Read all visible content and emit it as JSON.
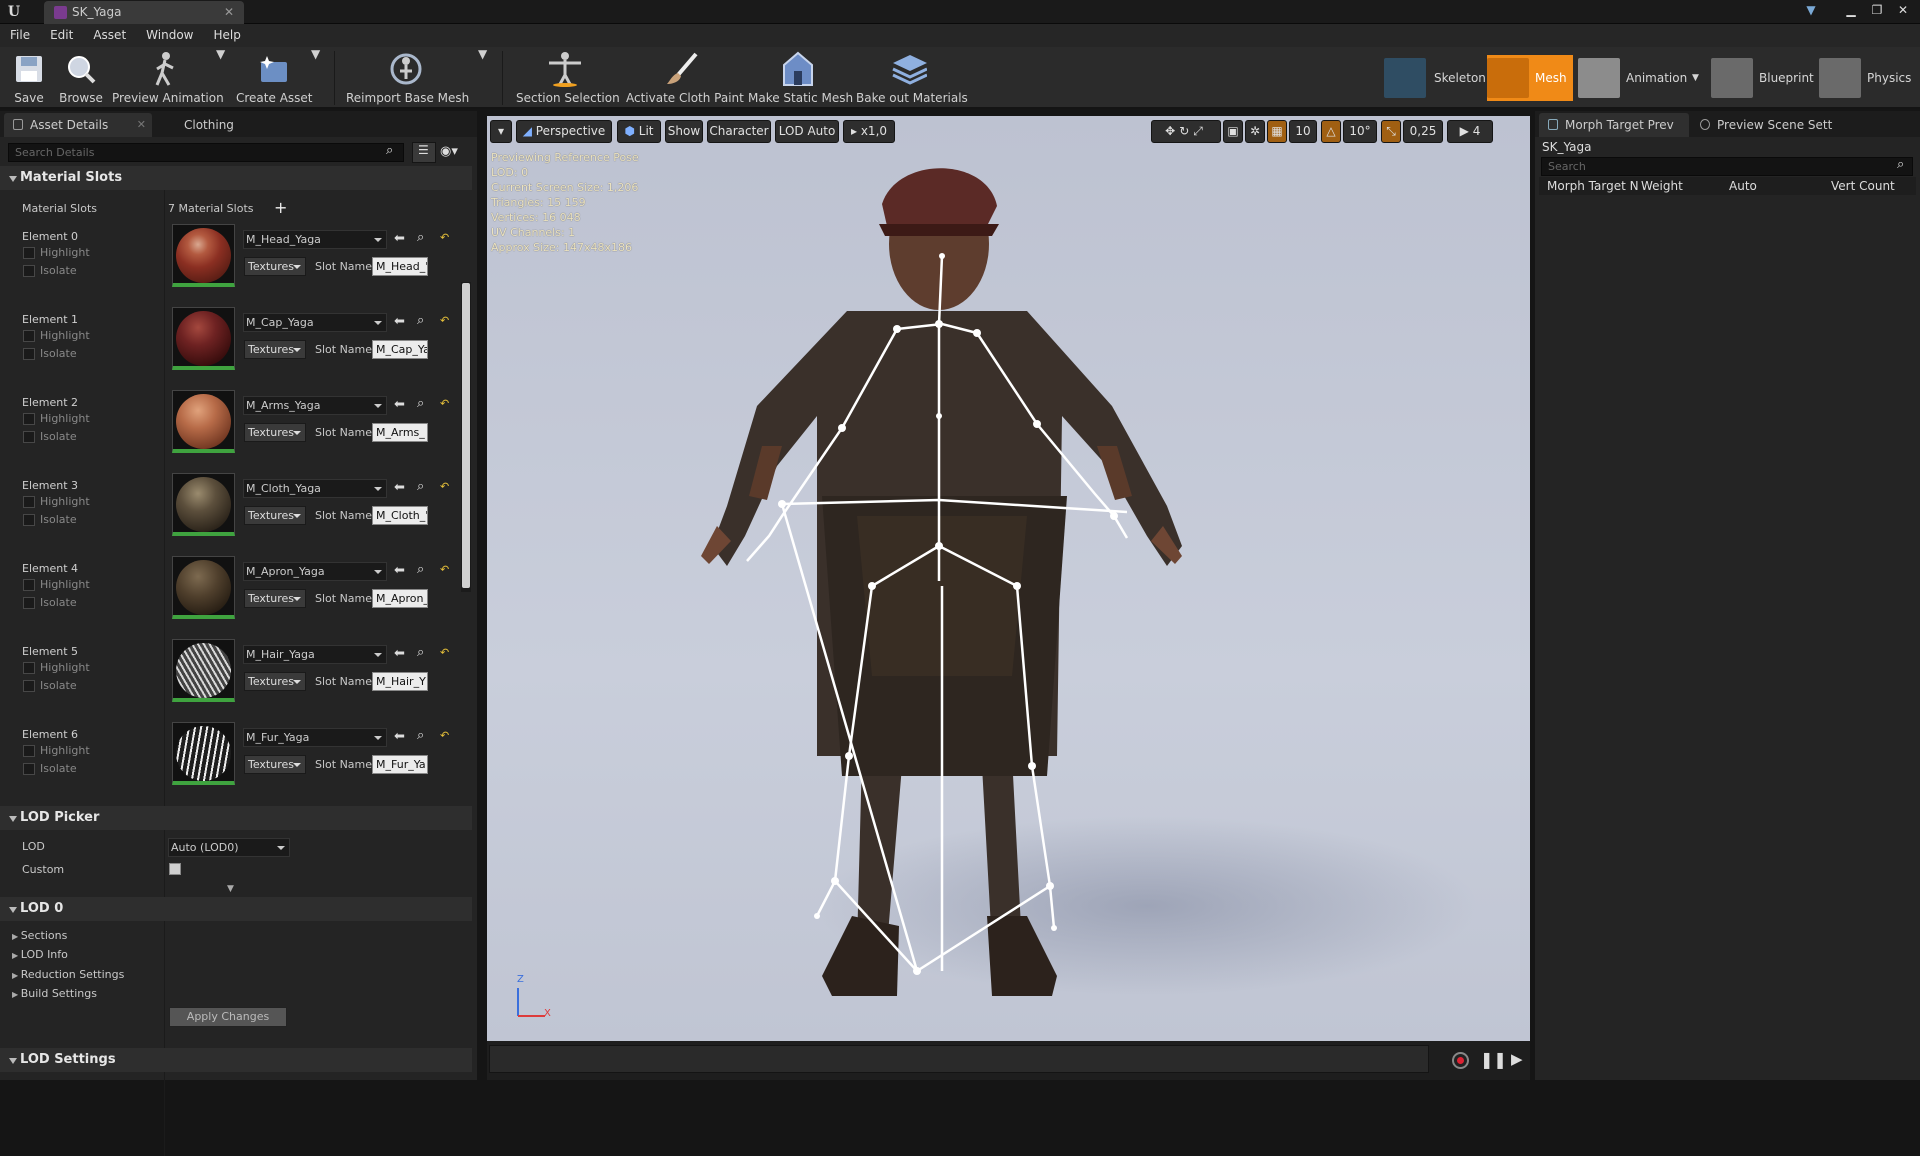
{
  "window": {
    "tab_title": "SK_Yaga",
    "controls": [
      "▁",
      "❐",
      "✕"
    ]
  },
  "menu": [
    "File",
    "Edit",
    "Asset",
    "Window",
    "Help"
  ],
  "toolbar": {
    "save": "Save",
    "browse": "Browse",
    "preview_animation": "Preview Animation",
    "create_asset": "Create Asset",
    "reimport": "Reimport Base Mesh",
    "section_selection": "Section Selection",
    "activate_cloth": "Activate Cloth Paint",
    "make_static": "Make Static Mesh",
    "bake_materials": "Bake out Materials"
  },
  "modes": {
    "skeleton": "Skeleton",
    "mesh": "Mesh",
    "animation": "Animation",
    "blueprint": "Blueprint",
    "physics": "Physics",
    "active": "Mesh",
    "accent": "#f08a17"
  },
  "left_panel": {
    "tabs": [
      "Asset Details",
      "Clothing"
    ],
    "search_placeholder": "Search Details",
    "material_slots": {
      "category": "Material Slots",
      "label": "Material Slots",
      "count": "7 Material Slots",
      "highlight": "Highlight",
      "isolate": "Isolate",
      "textures": "Textures",
      "slot_name_label": "Slot Name",
      "elements": [
        {
          "label": "Element 0",
          "material": "M_Head_Yaga",
          "slot": "M_Head_'"
        },
        {
          "label": "Element 1",
          "material": "M_Cap_Yaga",
          "slot": "M_Cap_Ya"
        },
        {
          "label": "Element 2",
          "material": "M_Arms_Yaga",
          "slot": "M_Arms_"
        },
        {
          "label": "Element 3",
          "material": "M_Cloth_Yaga",
          "slot": "M_Cloth_'"
        },
        {
          "label": "Element 4",
          "material": "M_Apron_Yaga",
          "slot": "M_Apron_"
        },
        {
          "label": "Element 5",
          "material": "M_Hair_Yaga",
          "slot": "M_Hair_Y"
        },
        {
          "label": "Element 6",
          "material": "M_Fur_Yaga",
          "slot": "M_Fur_Ya"
        }
      ]
    },
    "lod_picker": {
      "category": "LOD Picker",
      "lod_label": "LOD",
      "lod_value": "Auto (LOD0)",
      "custom_label": "Custom"
    },
    "lod0": {
      "category": "LOD 0",
      "items": [
        "Sections",
        "LOD Info",
        "Reduction Settings",
        "Build Settings"
      ],
      "apply": "Apply Changes"
    },
    "lod_settings": {
      "category": "LOD Settings"
    }
  },
  "viewport": {
    "buttons": {
      "perspective": "Perspective",
      "lit": "Lit",
      "show": "Show",
      "character": "Character",
      "lod": "LOD Auto",
      "speed": "x1,0"
    },
    "snap": {
      "grid": "10",
      "rot": "10°",
      "scale": "0,25",
      "cam": "4"
    },
    "info": [
      "Previewing Reference Pose",
      "LOD: 0",
      "Current Screen Size: 1,206",
      "Triangles: 15 159",
      "Vertices: 16 048",
      "UV Channels: 1",
      "Approx Size: 147x48x186"
    ],
    "axis": {
      "z": "Z",
      "x": "X"
    }
  },
  "right_panel": {
    "tabs": [
      "Morph Target Prev",
      "Preview Scene Sett"
    ],
    "mesh_name": "SK_Yaga",
    "search_placeholder": "Search",
    "columns": [
      "Morph Target N",
      "Weight",
      "Auto",
      "Vert Count"
    ]
  }
}
